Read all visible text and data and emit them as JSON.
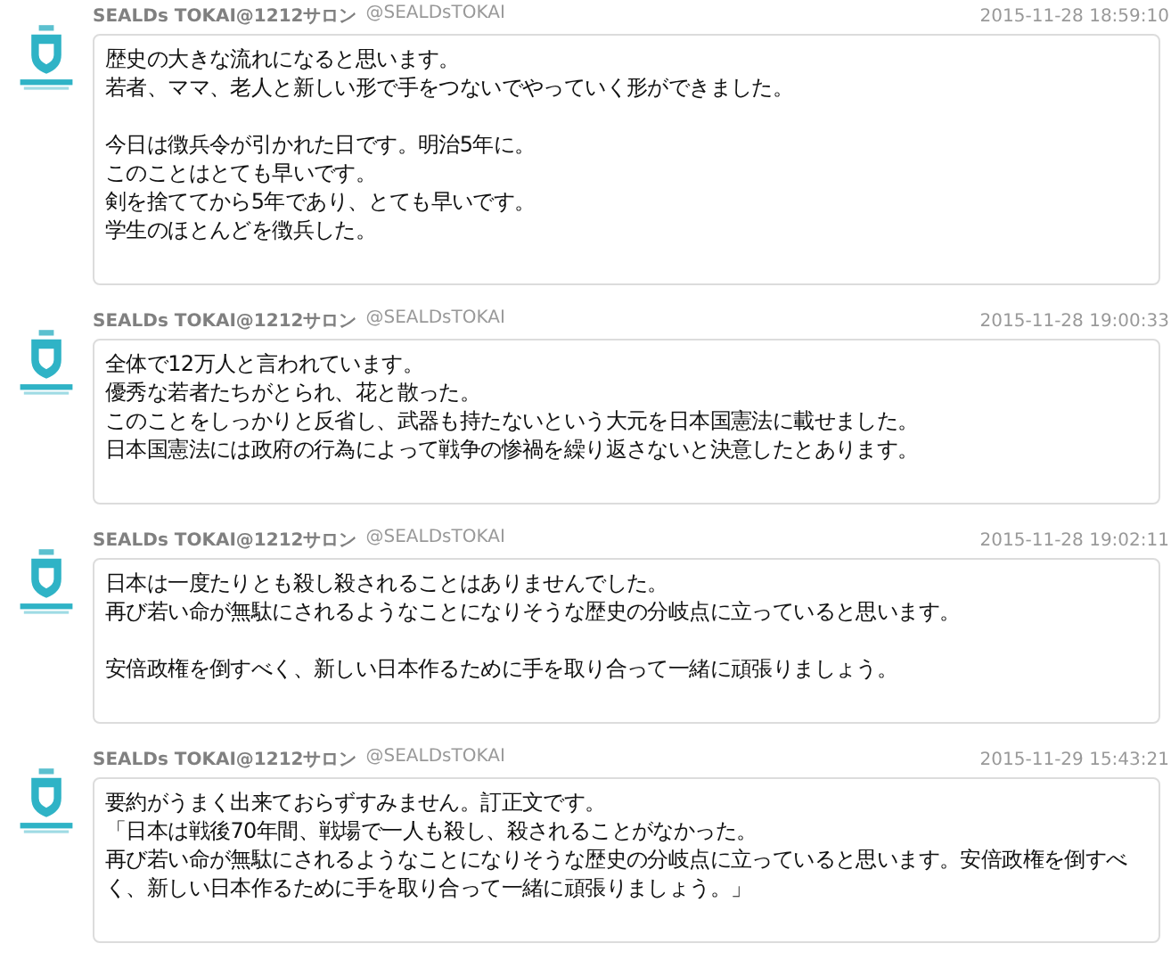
{
  "posts": [
    {
      "author": "SEALDs TOKAI@1212サロン",
      "handle": "@SEALDsTOKAI",
      "time": "2015-11-28 18:59:10",
      "paragraphs": [
        [
          "歴史の大きな流れになると思います。",
          "若者、ママ、老人と新しい形で手をつないでやっていく形ができました。"
        ],
        [
          "今日は徴兵令が引かれた日です。明治5年に。",
          "このことはとても早いです。",
          "剣を捨ててから5年であり、とても早いです。",
          "学生のほとんどを徴兵した。"
        ]
      ]
    },
    {
      "author": "SEALDs TOKAI@1212サロン",
      "handle": "@SEALDsTOKAI",
      "time": "2015-11-28 19:00:33",
      "paragraphs": [
        [
          "全体で12万人と言われています。",
          "優秀な若者たちがとられ、花と散った。",
          "このことをしっかりと反省し、武器も持たないという大元を日本国憲法に載せました。",
          "日本国憲法には政府の行為によって戦争の惨禍を繰り返さないと決意したとあります。"
        ]
      ]
    },
    {
      "author": "SEALDs TOKAI@1212サロン",
      "handle": "@SEALDsTOKAI",
      "time": "2015-11-28 19:02:11",
      "paragraphs": [
        [
          "日本は一度たりとも殺し殺されることはありませんでした。",
          "再び若い命が無駄にされるようなことになりそうな歴史の分岐点に立っていると思います。"
        ],
        [
          "安倍政権を倒すべく、新しい日本作るために手を取り合って一緒に頑張りましょう。"
        ]
      ]
    },
    {
      "author": "SEALDs TOKAI@1212サロン",
      "handle": "@SEALDsTOKAI",
      "time": "2015-11-29 15:43:21",
      "paragraphs": [
        [
          "要約がうまく出来ておらずすみません。訂正文です。",
          "「日本は戦後70年間、戦場で一人も殺し、殺されることがなかった。",
          "再び若い命が無駄にされるようなことになりそうな歴史の分岐点に立っていると思います。安倍政権を倒すべく、新しい日本作るために手を取り合って一緒に頑張りましょう。」"
        ]
      ]
    }
  ]
}
